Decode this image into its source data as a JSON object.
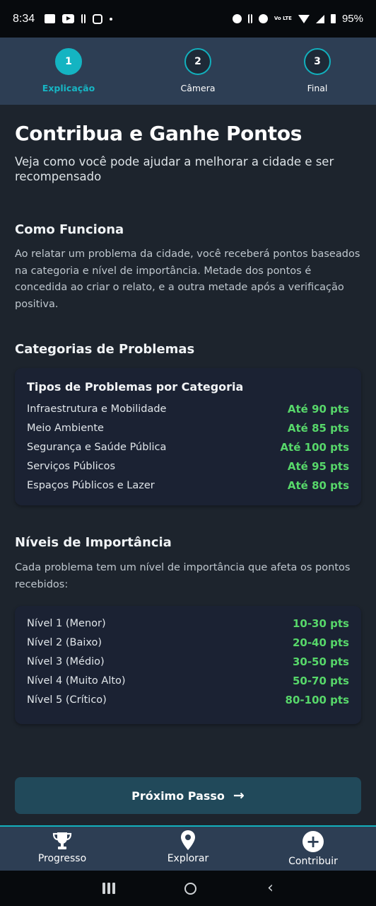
{
  "status_bar": {
    "time": "8:34",
    "battery": "95%",
    "lte": "Vo LTE"
  },
  "stepper": {
    "steps": [
      {
        "number": "1",
        "label": "Explicação",
        "active": true
      },
      {
        "number": "2",
        "label": "Câmera",
        "active": false
      },
      {
        "number": "3",
        "label": "Final",
        "active": false
      }
    ]
  },
  "page": {
    "title": "Contribua e Ganhe Pontos",
    "subtitle": "Veja como você pode ajudar a melhorar a cidade e ser recompensado"
  },
  "how_it_works": {
    "heading": "Como Funciona",
    "text": "Ao relatar um problema da cidade, você receberá pontos baseados na categoria e nível de importância. Metade dos pontos é concedida ao criar o relato, e a outra metade após a verificação positiva."
  },
  "categories": {
    "heading": "Categorias de Problemas",
    "card_title": "Tipos de Problemas por Categoria",
    "items": [
      {
        "name": "Infraestrutura e Mobilidade",
        "points": "Até 90 pts"
      },
      {
        "name": "Meio Ambiente",
        "points": "Até 85 pts"
      },
      {
        "name": "Segurança e Saúde Pública",
        "points": "Até 100 pts"
      },
      {
        "name": "Serviços Públicos",
        "points": "Até 95 pts"
      },
      {
        "name": "Espaços Públicos e Lazer",
        "points": "Até 80 pts"
      }
    ]
  },
  "levels": {
    "heading": "Níveis de Importância",
    "text": "Cada problema tem um nível de importância que afeta os pontos recebidos:",
    "items": [
      {
        "name": "Nível 1 (Menor)",
        "points": "10-30 pts"
      },
      {
        "name": "Nível 2 (Baixo)",
        "points": "20-40 pts"
      },
      {
        "name": "Nível 3 (Médio)",
        "points": "30-50 pts"
      },
      {
        "name": "Nível 4 (Muito Alto)",
        "points": "50-70 pts"
      },
      {
        "name": "Nível 5 (Crítico)",
        "points": "80-100 pts"
      }
    ]
  },
  "next_button": {
    "label": "Próximo Passo",
    "icon": "arrow-right-icon"
  },
  "bottom_nav": {
    "items": [
      {
        "label": "Progresso",
        "icon": "trophy-icon"
      },
      {
        "label": "Explorar",
        "icon": "map-pin-icon"
      },
      {
        "label": "Contribuir",
        "icon": "plus-circle-icon"
      }
    ]
  },
  "colors": {
    "accent": "#14b4c2",
    "points_green": "#57d76a",
    "header_bg": "#2d3e54",
    "page_bg": "#1d242d",
    "card_bg": "#1b2233",
    "button_bg": "#21495a"
  }
}
